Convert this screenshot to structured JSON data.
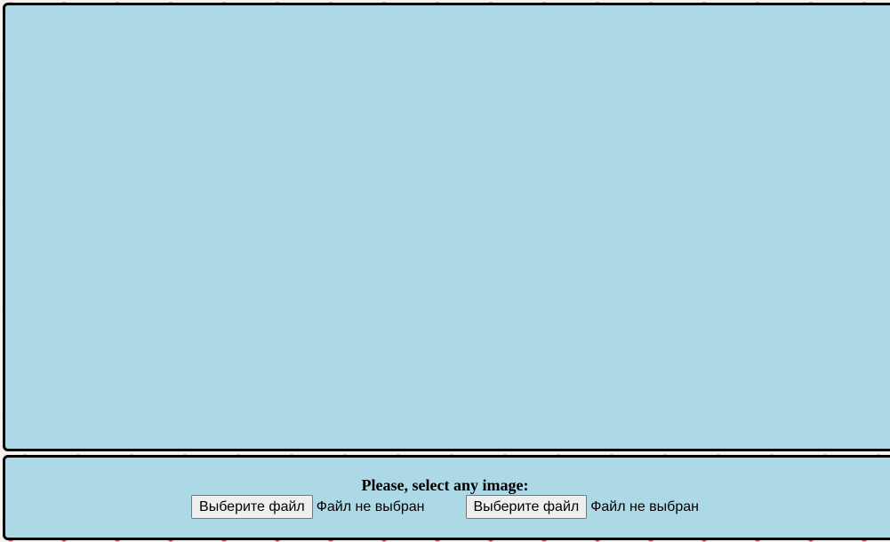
{
  "upload": {
    "heading": "Please, select any image:",
    "pickers": [
      {
        "button_label": "Выберите файл",
        "status": "Файл не выбран"
      },
      {
        "button_label": "Выберите файл",
        "status": "Файл не выбран"
      }
    ]
  },
  "colors": {
    "panel_background": "#add8e6",
    "panel_border": "#000000"
  }
}
